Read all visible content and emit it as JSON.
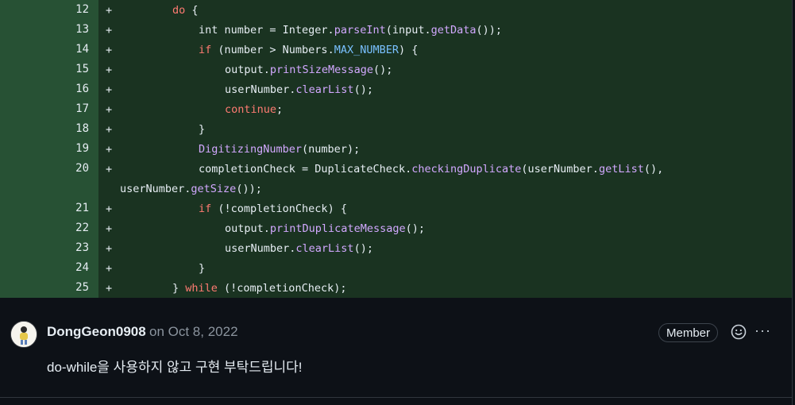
{
  "diff": {
    "lines": [
      {
        "num": "12",
        "tokens": [
          {
            "t": "do",
            "c": "kw"
          },
          {
            "t": " {",
            "c": ""
          }
        ]
      },
      {
        "num": "13",
        "tokens": [
          {
            "t": "int number = Integer.",
            "c": ""
          },
          {
            "t": "parseInt",
            "c": "fn"
          },
          {
            "t": "(input.",
            "c": ""
          },
          {
            "t": "getData",
            "c": "fn"
          },
          {
            "t": "());",
            "c": ""
          }
        ]
      },
      {
        "num": "14",
        "tokens": [
          {
            "t": "if",
            "c": "kw"
          },
          {
            "t": " (number > Numbers.",
            "c": ""
          },
          {
            "t": "MAX_NUMBER",
            "c": "cn"
          },
          {
            "t": ") {",
            "c": ""
          }
        ]
      },
      {
        "num": "15",
        "tokens": [
          {
            "t": "output.",
            "c": ""
          },
          {
            "t": "printSizeMessage",
            "c": "fn"
          },
          {
            "t": "();",
            "c": ""
          }
        ]
      },
      {
        "num": "16",
        "tokens": [
          {
            "t": "userNumber.",
            "c": ""
          },
          {
            "t": "clearList",
            "c": "fn"
          },
          {
            "t": "();",
            "c": ""
          }
        ]
      },
      {
        "num": "17",
        "tokens": [
          {
            "t": "continue",
            "c": "kw"
          },
          {
            "t": ";",
            "c": ""
          }
        ]
      },
      {
        "num": "18",
        "tokens": [
          {
            "t": "}",
            "c": ""
          }
        ]
      },
      {
        "num": "19",
        "tokens": [
          {
            "t": "DigitizingNumber",
            "c": "fn"
          },
          {
            "t": "(number);",
            "c": ""
          }
        ]
      },
      {
        "num": "20",
        "tokens": [
          {
            "t": "completionCheck = DuplicateCheck.",
            "c": ""
          },
          {
            "t": "checkingDuplicate",
            "c": "fn"
          },
          {
            "t": "(userNumber.",
            "c": ""
          },
          {
            "t": "getList",
            "c": "fn"
          },
          {
            "t": "(),",
            "c": ""
          }
        ],
        "wrap": [
          {
            "t": "userNumber.",
            "c": ""
          },
          {
            "t": "getSize",
            "c": "fn"
          },
          {
            "t": "());",
            "c": ""
          }
        ]
      },
      {
        "num": "21",
        "tokens": [
          {
            "t": "if",
            "c": "kw"
          },
          {
            "t": " (!completionCheck) {",
            "c": ""
          }
        ]
      },
      {
        "num": "22",
        "tokens": [
          {
            "t": "output.",
            "c": ""
          },
          {
            "t": "printDuplicateMessage",
            "c": "fn"
          },
          {
            "t": "();",
            "c": ""
          }
        ]
      },
      {
        "num": "23",
        "tokens": [
          {
            "t": "userNumber.",
            "c": ""
          },
          {
            "t": "clearList",
            "c": "fn"
          },
          {
            "t": "();",
            "c": ""
          }
        ]
      },
      {
        "num": "24",
        "tokens": [
          {
            "t": "}",
            "c": ""
          }
        ]
      },
      {
        "num": "25",
        "tokens": [
          {
            "t": "} ",
            "c": ""
          },
          {
            "t": "while",
            "c": "kw"
          },
          {
            "t": " (!completionCheck);",
            "c": ""
          }
        ]
      }
    ]
  },
  "comment": {
    "author": "DongGeon0908",
    "date": "on Oct 8, 2022",
    "badge": "Member",
    "more": "···",
    "body": "do-while을 사용하지 않고 구현 부탁드립니다!",
    "avatar_icon": "avatar",
    "reaction_icon": "smiley-icon"
  }
}
